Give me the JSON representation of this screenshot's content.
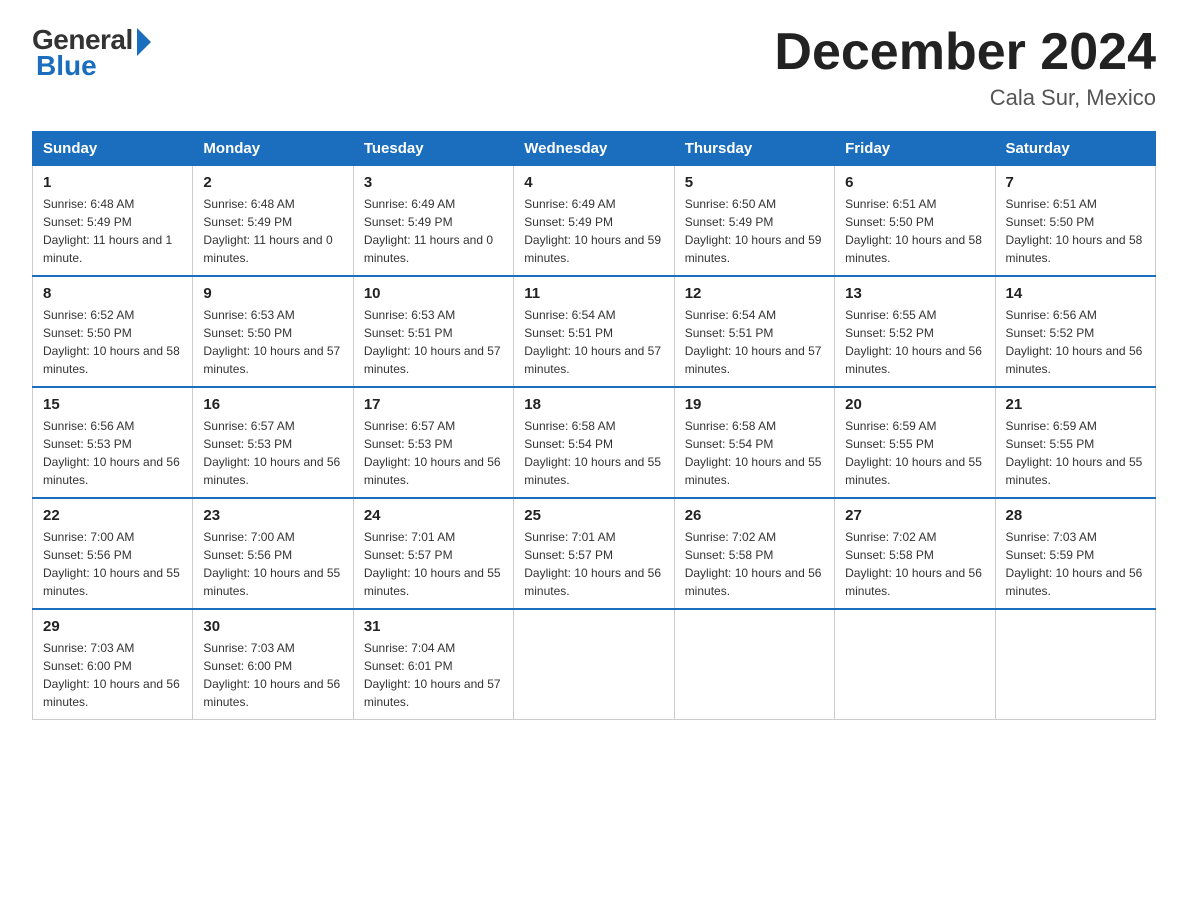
{
  "header": {
    "logo_general": "General",
    "logo_blue": "Blue",
    "month_title": "December 2024",
    "location": "Cala Sur, Mexico"
  },
  "days_of_week": [
    "Sunday",
    "Monday",
    "Tuesday",
    "Wednesday",
    "Thursday",
    "Friday",
    "Saturday"
  ],
  "weeks": [
    [
      {
        "num": "1",
        "sunrise": "6:48 AM",
        "sunset": "5:49 PM",
        "daylight": "11 hours and 1 minute."
      },
      {
        "num": "2",
        "sunrise": "6:48 AM",
        "sunset": "5:49 PM",
        "daylight": "11 hours and 0 minutes."
      },
      {
        "num": "3",
        "sunrise": "6:49 AM",
        "sunset": "5:49 PM",
        "daylight": "11 hours and 0 minutes."
      },
      {
        "num": "4",
        "sunrise": "6:49 AM",
        "sunset": "5:49 PM",
        "daylight": "10 hours and 59 minutes."
      },
      {
        "num": "5",
        "sunrise": "6:50 AM",
        "sunset": "5:49 PM",
        "daylight": "10 hours and 59 minutes."
      },
      {
        "num": "6",
        "sunrise": "6:51 AM",
        "sunset": "5:50 PM",
        "daylight": "10 hours and 58 minutes."
      },
      {
        "num": "7",
        "sunrise": "6:51 AM",
        "sunset": "5:50 PM",
        "daylight": "10 hours and 58 minutes."
      }
    ],
    [
      {
        "num": "8",
        "sunrise": "6:52 AM",
        "sunset": "5:50 PM",
        "daylight": "10 hours and 58 minutes."
      },
      {
        "num": "9",
        "sunrise": "6:53 AM",
        "sunset": "5:50 PM",
        "daylight": "10 hours and 57 minutes."
      },
      {
        "num": "10",
        "sunrise": "6:53 AM",
        "sunset": "5:51 PM",
        "daylight": "10 hours and 57 minutes."
      },
      {
        "num": "11",
        "sunrise": "6:54 AM",
        "sunset": "5:51 PM",
        "daylight": "10 hours and 57 minutes."
      },
      {
        "num": "12",
        "sunrise": "6:54 AM",
        "sunset": "5:51 PM",
        "daylight": "10 hours and 57 minutes."
      },
      {
        "num": "13",
        "sunrise": "6:55 AM",
        "sunset": "5:52 PM",
        "daylight": "10 hours and 56 minutes."
      },
      {
        "num": "14",
        "sunrise": "6:56 AM",
        "sunset": "5:52 PM",
        "daylight": "10 hours and 56 minutes."
      }
    ],
    [
      {
        "num": "15",
        "sunrise": "6:56 AM",
        "sunset": "5:53 PM",
        "daylight": "10 hours and 56 minutes."
      },
      {
        "num": "16",
        "sunrise": "6:57 AM",
        "sunset": "5:53 PM",
        "daylight": "10 hours and 56 minutes."
      },
      {
        "num": "17",
        "sunrise": "6:57 AM",
        "sunset": "5:53 PM",
        "daylight": "10 hours and 56 minutes."
      },
      {
        "num": "18",
        "sunrise": "6:58 AM",
        "sunset": "5:54 PM",
        "daylight": "10 hours and 55 minutes."
      },
      {
        "num": "19",
        "sunrise": "6:58 AM",
        "sunset": "5:54 PM",
        "daylight": "10 hours and 55 minutes."
      },
      {
        "num": "20",
        "sunrise": "6:59 AM",
        "sunset": "5:55 PM",
        "daylight": "10 hours and 55 minutes."
      },
      {
        "num": "21",
        "sunrise": "6:59 AM",
        "sunset": "5:55 PM",
        "daylight": "10 hours and 55 minutes."
      }
    ],
    [
      {
        "num": "22",
        "sunrise": "7:00 AM",
        "sunset": "5:56 PM",
        "daylight": "10 hours and 55 minutes."
      },
      {
        "num": "23",
        "sunrise": "7:00 AM",
        "sunset": "5:56 PM",
        "daylight": "10 hours and 55 minutes."
      },
      {
        "num": "24",
        "sunrise": "7:01 AM",
        "sunset": "5:57 PM",
        "daylight": "10 hours and 55 minutes."
      },
      {
        "num": "25",
        "sunrise": "7:01 AM",
        "sunset": "5:57 PM",
        "daylight": "10 hours and 56 minutes."
      },
      {
        "num": "26",
        "sunrise": "7:02 AM",
        "sunset": "5:58 PM",
        "daylight": "10 hours and 56 minutes."
      },
      {
        "num": "27",
        "sunrise": "7:02 AM",
        "sunset": "5:58 PM",
        "daylight": "10 hours and 56 minutes."
      },
      {
        "num": "28",
        "sunrise": "7:03 AM",
        "sunset": "5:59 PM",
        "daylight": "10 hours and 56 minutes."
      }
    ],
    [
      {
        "num": "29",
        "sunrise": "7:03 AM",
        "sunset": "6:00 PM",
        "daylight": "10 hours and 56 minutes."
      },
      {
        "num": "30",
        "sunrise": "7:03 AM",
        "sunset": "6:00 PM",
        "daylight": "10 hours and 56 minutes."
      },
      {
        "num": "31",
        "sunrise": "7:04 AM",
        "sunset": "6:01 PM",
        "daylight": "10 hours and 57 minutes."
      },
      null,
      null,
      null,
      null
    ]
  ]
}
